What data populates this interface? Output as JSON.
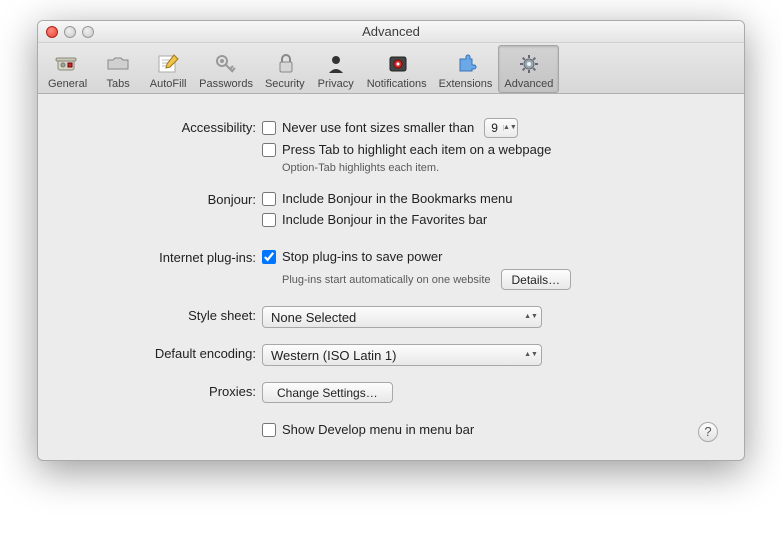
{
  "title": "Advanced",
  "toolbar": [
    {
      "label": "General"
    },
    {
      "label": "Tabs"
    },
    {
      "label": "AutoFill"
    },
    {
      "label": "Passwords"
    },
    {
      "label": "Security"
    },
    {
      "label": "Privacy"
    },
    {
      "label": "Notifications"
    },
    {
      "label": "Extensions"
    },
    {
      "label": "Advanced"
    }
  ],
  "accessibility": {
    "label": "Accessibility:",
    "never_smaller": "Never use font sizes smaller than",
    "font_size_value": "9",
    "press_tab": "Press Tab to highlight each item on a webpage",
    "hint": "Option-Tab highlights each item."
  },
  "bonjour": {
    "label": "Bonjour:",
    "bookmarks": "Include Bonjour in the Bookmarks menu",
    "favorites": "Include Bonjour in the Favorites bar"
  },
  "plugins": {
    "label": "Internet plug-ins:",
    "stop": "Stop plug-ins to save power",
    "hint": "Plug-ins start automatically on one website",
    "details": "Details…"
  },
  "stylesheet": {
    "label": "Style sheet:",
    "value": "None Selected"
  },
  "encoding": {
    "label": "Default encoding:",
    "value": "Western (ISO Latin 1)"
  },
  "proxies": {
    "label": "Proxies:",
    "button": "Change Settings…"
  },
  "develop": "Show Develop menu in menu bar",
  "help": "?"
}
